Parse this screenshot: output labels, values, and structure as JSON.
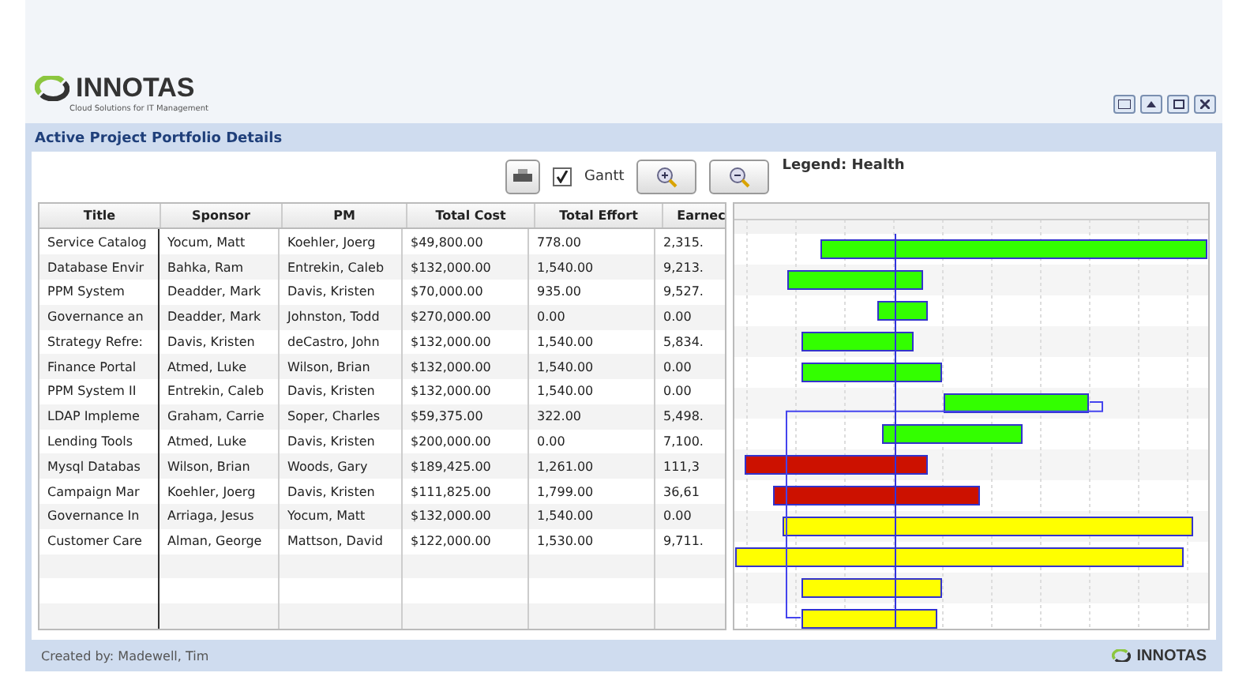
{
  "header": {
    "logo": "INNOTAS",
    "tagline": "Cloud Solutions for IT Management"
  },
  "panel": {
    "title": "Active Project Portfolio Details"
  },
  "toolbar": {
    "gantt": {
      "label": "Gantt",
      "checked": true
    },
    "legend": "Legend: Health"
  },
  "table": {
    "columns": [
      "Title",
      "Sponsor",
      "PM",
      "Total Cost",
      "Total Effort",
      "Earnec"
    ],
    "rows": [
      [
        "Service Catalog",
        "Yocum, Matt",
        "Koehler, Joerg",
        "$49,800.00",
        "778.00",
        "2,315."
      ],
      [
        "Database Envir",
        "Bahka, Ram",
        "Entrekin, Caleb",
        "$132,000.00",
        "1,540.00",
        "9,213."
      ],
      [
        "PPM System",
        "Deadder, Mark",
        "Davis, Kristen",
        "$70,000.00",
        "935.00",
        "9,527."
      ],
      [
        "Governance an",
        "Deadder, Mark",
        "Johnston, Todd",
        "$270,000.00",
        "0.00",
        "0.00"
      ],
      [
        "Strategy Refre:",
        "Davis, Kristen",
        "deCastro, John",
        "$132,000.00",
        "1,540.00",
        "5,834."
      ],
      [
        "Finance Portal",
        "Atmed, Luke",
        "Wilson, Brian",
        "$132,000.00",
        "1,540.00",
        "0.00"
      ],
      [
        "PPM System II",
        "Entrekin, Caleb",
        "Davis, Kristen",
        "$132,000.00",
        "1,540.00",
        "0.00"
      ],
      [
        "LDAP Impleme",
        "Graham, Carrie",
        "Soper, Charles",
        "$59,375.00",
        "322.00",
        "5,498."
      ],
      [
        "Lending Tools",
        "Atmed, Luke",
        "Davis, Kristen",
        "$200,000.00",
        "0.00",
        "7,100."
      ],
      [
        "Mysql Databas",
        "Wilson, Brian",
        "Woods, Gary",
        "$189,425.00",
        "1,261.00",
        "111,3"
      ],
      [
        "Campaign Mar",
        "Koehler, Joerg",
        "Davis, Kristen",
        "$111,825.00",
        "1,799.00",
        "36,61"
      ],
      [
        "Governance In",
        "Arriaga, Jesus",
        "Yocum, Matt",
        "$132,000.00",
        "1,540.00",
        "0.00"
      ],
      [
        "Customer Care",
        "Alman, George",
        "Mattson, David",
        "$122,000.00",
        "1,530.00",
        "9,711."
      ]
    ]
  },
  "gantt": {
    "bars": [
      {
        "color": "#33ff00"
      },
      {
        "color": "#33ff00"
      },
      {
        "color": "#33ff00"
      },
      {
        "color": "#33ff00"
      },
      {
        "color": "#33ff00"
      },
      {
        "color": "#33ff00"
      },
      {
        "color": "#33ff00"
      },
      {
        "color": "#cc1100"
      },
      {
        "color": "#cc1100"
      },
      {
        "color": "#ffff00"
      },
      {
        "color": "#ffff00"
      },
      {
        "color": "#ffff00"
      },
      {
        "color": "#ffff00"
      }
    ]
  },
  "footer": {
    "created_by": "Created by: Madewell, Tim",
    "logo": "INNOTAS"
  }
}
